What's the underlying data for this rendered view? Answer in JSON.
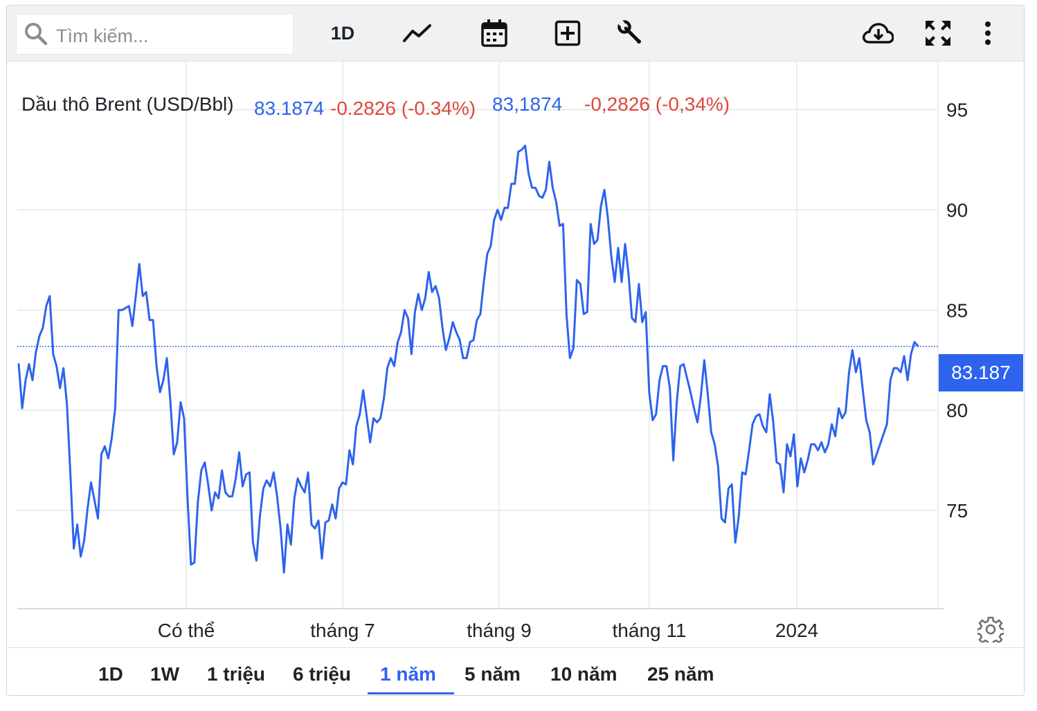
{
  "toolbar": {
    "search_placeholder": "Tìm kiếm...",
    "interval_label": "1D",
    "icons": [
      "search-icon",
      "line-chart-icon",
      "calendar-icon",
      "add-box-icon",
      "wrench-icon",
      "cloud-download-icon",
      "fullscreen-icon",
      "more-vertical-icon"
    ]
  },
  "legend": {
    "name": "Dầu thô Brent (USD/Bbl)",
    "value": "83.1874",
    "change": "-0.2826 (-0.34%)",
    "value_alt": "83,1874",
    "change_alt": "-0,2826 (-0,34%)"
  },
  "price_tag": "83.187",
  "ranges": [
    {
      "label": "1D",
      "active": false
    },
    {
      "label": "1W",
      "active": false
    },
    {
      "label": "1 triệu",
      "active": false
    },
    {
      "label": "6 triệu",
      "active": false
    },
    {
      "label": "1 năm",
      "active": true
    },
    {
      "label": "5 năm",
      "active": false
    },
    {
      "label": "10 năm",
      "active": false
    },
    {
      "label": "25 năm",
      "active": false
    }
  ],
  "colors": {
    "line": "#2d63ed",
    "up": "#2d63ed",
    "down": "#e0463a",
    "grid": "#e3e5e8"
  },
  "chart_data": {
    "type": "line",
    "series": [
      {
        "name": "Dầu thô Brent (USD/Bbl)",
        "values": [
          82.3,
          80.1,
          81.5,
          82.3,
          81.5,
          82.9,
          83.7,
          84.1,
          85.2,
          85.7,
          82.8,
          82.2,
          81.1,
          82.1,
          80.3,
          76.8,
          73.1,
          74.3,
          72.7,
          73.5,
          75.1,
          76.4,
          75.5,
          74.6,
          77.8,
          78.2,
          77.6,
          78.6,
          80.1,
          85.0,
          85.0,
          85.1,
          85.2,
          84.2,
          85.7,
          87.3,
          85.7,
          85.9,
          84.5,
          84.5,
          82.2,
          80.9,
          81.5,
          82.6,
          80.5,
          77.8,
          78.4,
          80.4,
          79.6,
          75.6,
          72.3,
          72.4,
          75.4,
          77.0,
          77.4,
          76.3,
          75.0,
          75.9,
          75.6,
          77.0,
          75.9,
          75.7,
          75.7,
          76.6,
          77.9,
          76.2,
          76.8,
          76.9,
          73.4,
          72.5,
          74.7,
          76.1,
          76.5,
          76.2,
          76.9,
          75.7,
          74.1,
          71.9,
          74.3,
          73.3,
          75.6,
          76.6,
          76.2,
          75.9,
          76.9,
          74.3,
          74.1,
          74.5,
          72.6,
          74.4,
          74.5,
          75.3,
          74.6,
          76.1,
          76.4,
          76.3,
          78.0,
          77.3,
          79.2,
          79.8,
          81.0,
          79.7,
          78.4,
          79.6,
          79.4,
          79.6,
          80.6,
          82.1,
          82.6,
          82.2,
          83.4,
          83.9,
          85.0,
          84.6,
          82.8,
          84.9,
          85.8,
          85.0,
          85.6,
          86.9,
          85.9,
          86.2,
          85.6,
          84.1,
          83.0,
          83.6,
          84.4,
          83.9,
          83.5,
          82.6,
          82.6,
          83.4,
          83.5,
          84.5,
          84.8,
          86.4,
          87.8,
          88.2,
          89.5,
          90.0,
          89.5,
          90.1,
          90.1,
          91.3,
          91.3,
          92.9,
          93.0,
          93.2,
          91.8,
          91.1,
          91.1,
          90.7,
          90.6,
          91.0,
          92.4,
          91.1,
          90.4,
          89.2,
          89.3,
          84.8,
          82.6,
          83.1,
          86.5,
          86.3,
          84.8,
          84.9,
          89.3,
          88.3,
          88.5,
          90.2,
          91.0,
          89.6,
          87.7,
          86.4,
          88.1,
          86.4,
          88.3,
          86.8,
          84.6,
          84.4,
          86.3,
          84.4,
          84.9,
          80.9,
          79.5,
          79.8,
          81.5,
          82.2,
          82.2,
          81.1,
          77.5,
          80.4,
          82.2,
          82.3,
          81.6,
          80.9,
          80.1,
          79.4,
          80.7,
          82.5,
          80.8,
          78.9,
          78.3,
          77.2,
          74.6,
          74.4,
          76.1,
          76.3,
          73.4,
          74.7,
          76.9,
          76.8,
          78.0,
          79.3,
          79.7,
          79.8,
          79.2,
          78.9,
          80.8,
          79.4,
          77.4,
          77.3,
          75.9,
          78.3,
          77.7,
          78.8,
          76.2,
          77.6,
          76.9,
          77.5,
          78.3,
          78.3,
          78.0,
          78.4,
          77.9,
          78.3,
          79.3,
          78.7,
          80.1,
          79.6,
          79.9,
          81.9,
          83.0,
          81.9,
          82.6,
          81.0,
          79.5,
          78.9,
          77.3,
          77.8,
          78.3,
          78.8,
          79.3,
          81.5,
          82.1,
          82.1,
          81.9,
          82.7,
          81.5,
          82.8,
          83.4,
          83.2
        ],
        "color": "#2d63ed"
      }
    ],
    "x_labels": [
      "Có thể",
      "tháng 7",
      "tháng 9",
      "tháng 11",
      "2024"
    ],
    "y_ticks": [
      95,
      90,
      85,
      80,
      75
    ],
    "ylim": [
      70.1,
      97.4
    ],
    "last_value": 83.187,
    "grid": true
  }
}
